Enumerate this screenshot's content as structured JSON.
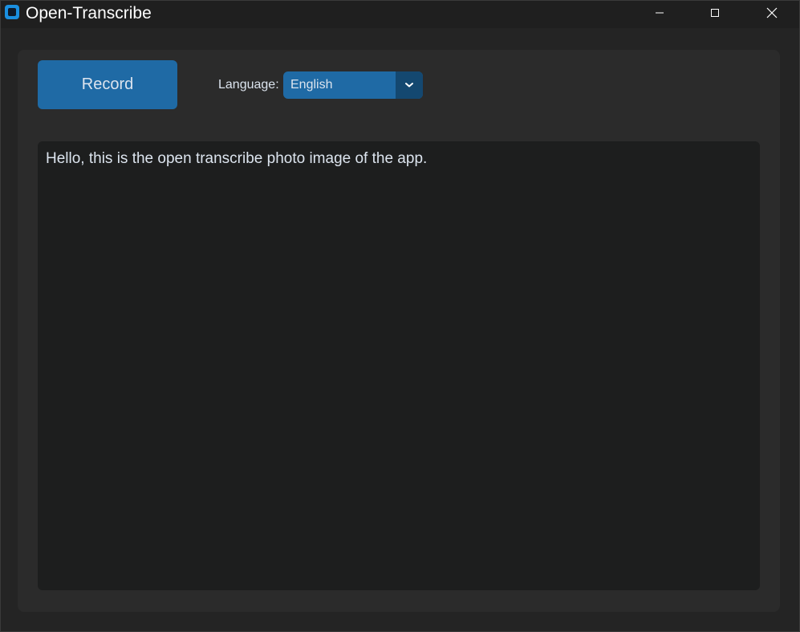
{
  "window": {
    "title": "Open-Transcribe",
    "controls": {
      "minimize_icon": "minimize-icon",
      "maximize_icon": "maximize-icon",
      "close_icon": "close-icon"
    }
  },
  "toolbar": {
    "record_label": "Record",
    "language_label": "Language:",
    "language_value": "English"
  },
  "transcript": {
    "text": "Hello, this is the open transcribe photo image of the app."
  },
  "colors": {
    "accent": "#1f6aa5",
    "accent_dark": "#144870",
    "panel": "#2b2b2b",
    "textbox": "#1d1e1e",
    "text": "#dce4ee"
  }
}
